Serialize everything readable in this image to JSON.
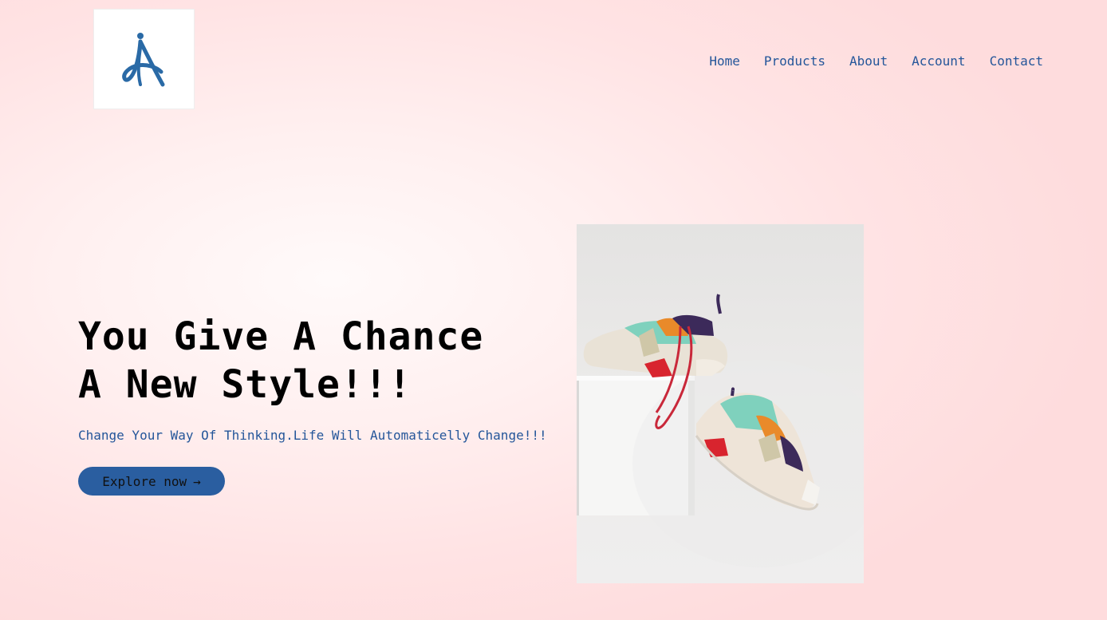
{
  "header": {
    "logo_alt": "Logo",
    "nav": [
      {
        "label": "Home"
      },
      {
        "label": "Products"
      },
      {
        "label": "About"
      },
      {
        "label": "Account"
      },
      {
        "label": "Contact"
      }
    ]
  },
  "hero": {
    "title_line1": "You Give A Chance",
    "title_line2": "A New Style!!!",
    "subtitle": "Change Your Way Of Thinking.Life Will Automaticelly Change!!!",
    "cta_label": "Explore now",
    "cta_arrow": "→",
    "image_alt": "sneakers"
  },
  "colors": {
    "accent": "#2a5ea0",
    "link": "#24569a",
    "background": "#fedcdd"
  },
  "icons": {
    "logo": "letter-a-person-logo",
    "cta": "arrow-right-icon"
  }
}
